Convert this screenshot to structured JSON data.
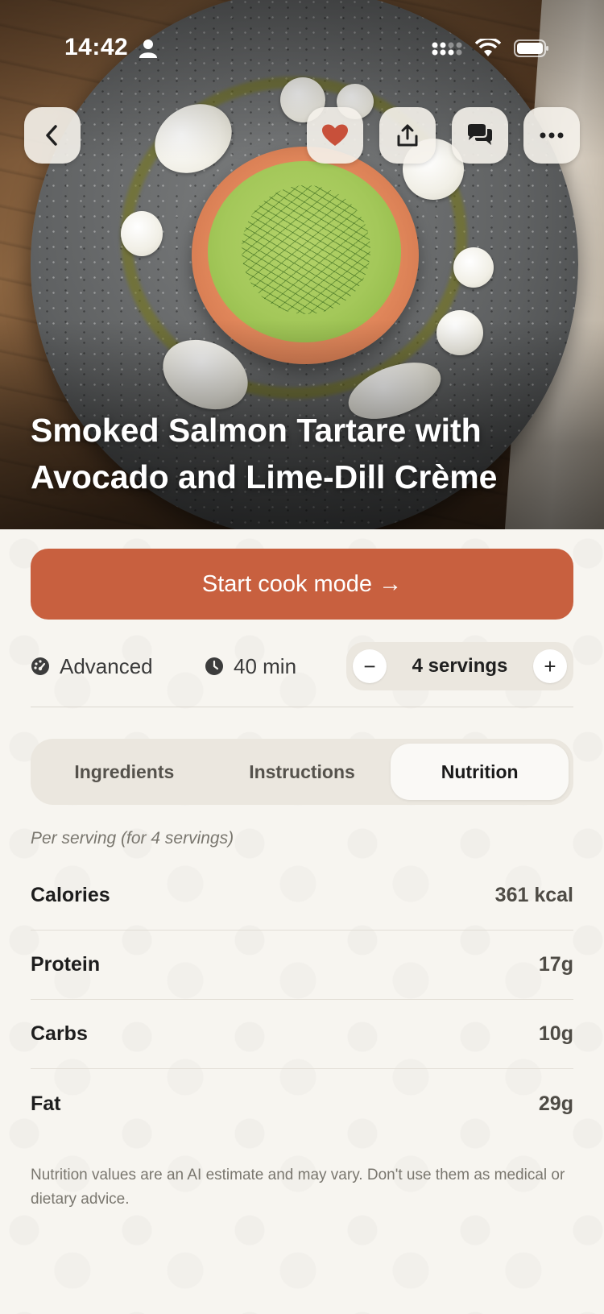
{
  "status_bar": {
    "time": "14:42"
  },
  "recipe": {
    "title": "Smoked Salmon Tartare with Avocado and Lime-Dill Crème"
  },
  "actions": {
    "cook_mode_label": "Start cook mode →"
  },
  "meta": {
    "difficulty": "Advanced",
    "time": "40 min",
    "servings_label": "4 servings",
    "minus": "−",
    "plus": "+"
  },
  "tabs": [
    {
      "label": "Ingredients",
      "active": false
    },
    {
      "label": "Instructions",
      "active": false
    },
    {
      "label": "Nutrition",
      "active": true
    }
  ],
  "nutrition": {
    "per_serving_note": "Per serving (for 4 servings)",
    "rows": [
      {
        "label": "Calories",
        "value": "361 kcal"
      },
      {
        "label": "Protein",
        "value": "17g"
      },
      {
        "label": "Carbs",
        "value": "10g"
      },
      {
        "label": "Fat",
        "value": "29g"
      }
    ],
    "disclaimer": "Nutrition values are an AI estimate and may vary. Don't use them as medical or dietary advice."
  },
  "icons": {
    "back": "chevron-left-icon",
    "favorite": "heart-icon",
    "share": "share-icon",
    "comments": "chat-bubbles-icon",
    "more": "more-horizontal-icon"
  },
  "colors": {
    "accent": "#c8603f",
    "heart": "#c8503a",
    "background": "#f7f5f0"
  }
}
